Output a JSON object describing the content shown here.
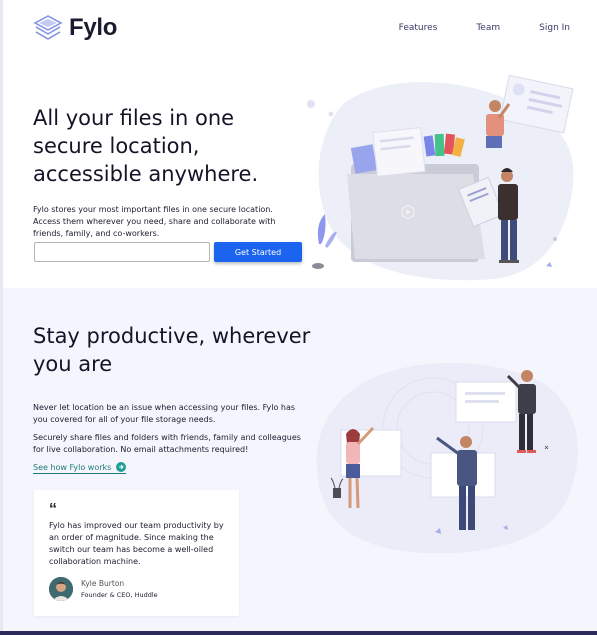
{
  "brand": {
    "name": "Fylo",
    "logo_icon": "stacked-layers-icon",
    "accent": "#1a64f0",
    "link_color": "#1e7a78"
  },
  "nav": {
    "items": [
      {
        "label": "Features"
      },
      {
        "label": "Team"
      },
      {
        "label": "Sign In"
      }
    ]
  },
  "hero": {
    "title": "All your files in one secure location, accessible anywhere.",
    "text": "Fylo stores your most important files in one secure location. Access them wherever you need, share and collaborate with friends, family, and co-workers.",
    "email_value": "",
    "email_placeholder": "",
    "cta_label": "Get Started"
  },
  "productive": {
    "title": "Stay productive, wherever you are",
    "p1": "Never let location be an issue when accessing your files. Fylo has you covered for all of your file storage needs.",
    "p2": "Securely share files and folders with friends, family and colleagues for live collaboration. No email attachments required!",
    "link_label": "See how Fylo works",
    "link_icon": "arrow-right-icon"
  },
  "testimonial": {
    "quote_mark": "“",
    "text": "Fylo has improved our team productivity by an order of magnitude. Since making the switch our team has become a well-oiled collaboration machine.",
    "name": "Kyle Burton",
    "role": "Founder & CEO, Huddle"
  }
}
